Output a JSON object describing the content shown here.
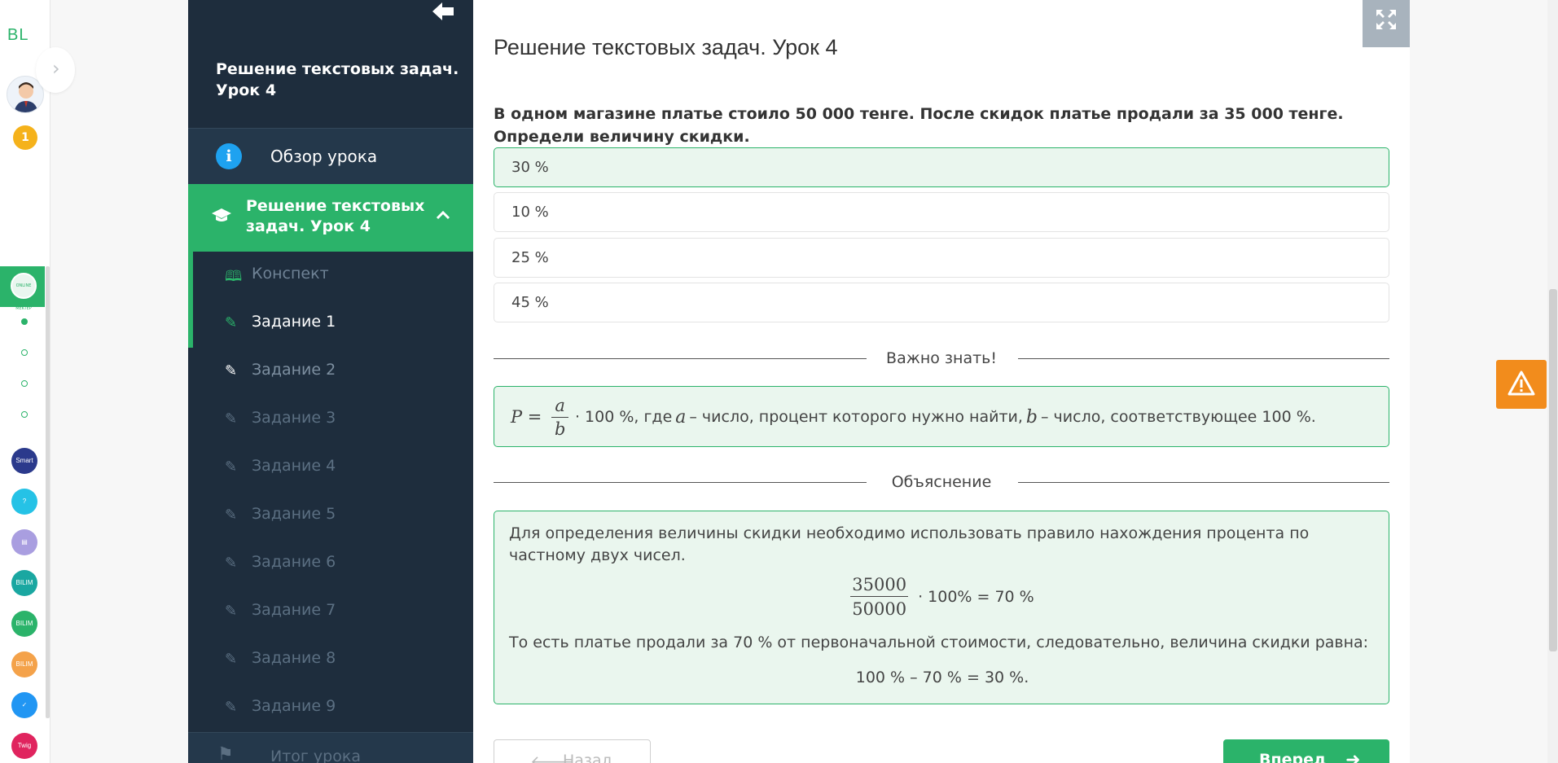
{
  "rail": {
    "logo": "BL",
    "badge_count": "1",
    "active_app_label": "ONLINE MEKTEP",
    "apps": [
      {
        "name": "smart-nation-app",
        "label": "Smart Nation",
        "color": "#2b3a8c"
      },
      {
        "name": "help-app",
        "label": "?",
        "color": "#25c2e6"
      },
      {
        "name": "news-app",
        "label": "▤",
        "color": "#a99ee0"
      },
      {
        "name": "bilim-online-app",
        "label": "BILIM",
        "color": "#1aa7a1"
      },
      {
        "name": "bilim-land-app",
        "label": "BILIM Land",
        "color": "#2bb36a"
      },
      {
        "name": "bilim-shop-app",
        "label": "BILIM SHOP",
        "color": "#f4a24a"
      },
      {
        "name": "mail-app",
        "label": "✓",
        "color": "#2196f3"
      },
      {
        "name": "twig-app",
        "label": "Twig",
        "color": "#e0245e"
      }
    ]
  },
  "sidebar": {
    "course_title": "Решение текстовых задач. Урок 4",
    "overview_label": "Обзор урока",
    "lesson_label": "Решение текстовых задач. Урок 4",
    "items": [
      {
        "label": "Конспект",
        "state": "done",
        "icon": "book-icon"
      },
      {
        "label": "Задание 1",
        "state": "current",
        "icon": "edit-icon"
      },
      {
        "label": "Задание 2",
        "state": "bright",
        "icon": "edit-icon"
      },
      {
        "label": "Задание 3",
        "state": "dim",
        "icon": "edit-icon"
      },
      {
        "label": "Задание 4",
        "state": "dim",
        "icon": "edit-icon"
      },
      {
        "label": "Задание 5",
        "state": "dim",
        "icon": "edit-icon"
      },
      {
        "label": "Задание 6",
        "state": "dim",
        "icon": "edit-icon"
      },
      {
        "label": "Задание 7",
        "state": "dim",
        "icon": "edit-icon"
      },
      {
        "label": "Задание 8",
        "state": "dim",
        "icon": "edit-icon"
      },
      {
        "label": "Задание 9",
        "state": "dim",
        "icon": "edit-icon"
      }
    ],
    "result_label": "Итог урока"
  },
  "main": {
    "title": "Решение текстовых задач. Урок 4",
    "question": "В одном магазине платье стоило 50 000 тенге. После скидок платье продали за 35 000 тенге. Определи величину скидки.",
    "options": [
      {
        "label": "30 %",
        "correct": true
      },
      {
        "label": "10 %",
        "correct": false
      },
      {
        "label": "25 %",
        "correct": false
      },
      {
        "label": "45 %",
        "correct": false
      }
    ],
    "important_heading": "Важно знать!",
    "formula": {
      "lhs": "P =",
      "num": "a",
      "den": "b",
      "text_a": "· 100 %, где",
      "var_a": "a",
      "text_b": "– число, процент которого нужно найти,",
      "var_b": "b",
      "text_c": "– число, соответствующее 100 %."
    },
    "explanation_heading": "Объяснение",
    "explanation": {
      "p1": "Для определения величины скидки необходимо использовать правило нахождения процента по частному двух чисел.",
      "num": "35000",
      "den": "50000",
      "calc_rest": "· 100% = 70 %",
      "p2": "То есть платье продали за 70 % от первоначальной стоимости, следовательно, величина скидки равна:",
      "p3": "100 % – 70 % = 30 %."
    },
    "back_label": "Назад",
    "next_label": "Вперед"
  },
  "colors": {
    "accent": "#2bb36a",
    "sidebar_bg": "#1e2d3d",
    "correct_bg": "#eaf6ee",
    "warning": "#f28c1c"
  }
}
